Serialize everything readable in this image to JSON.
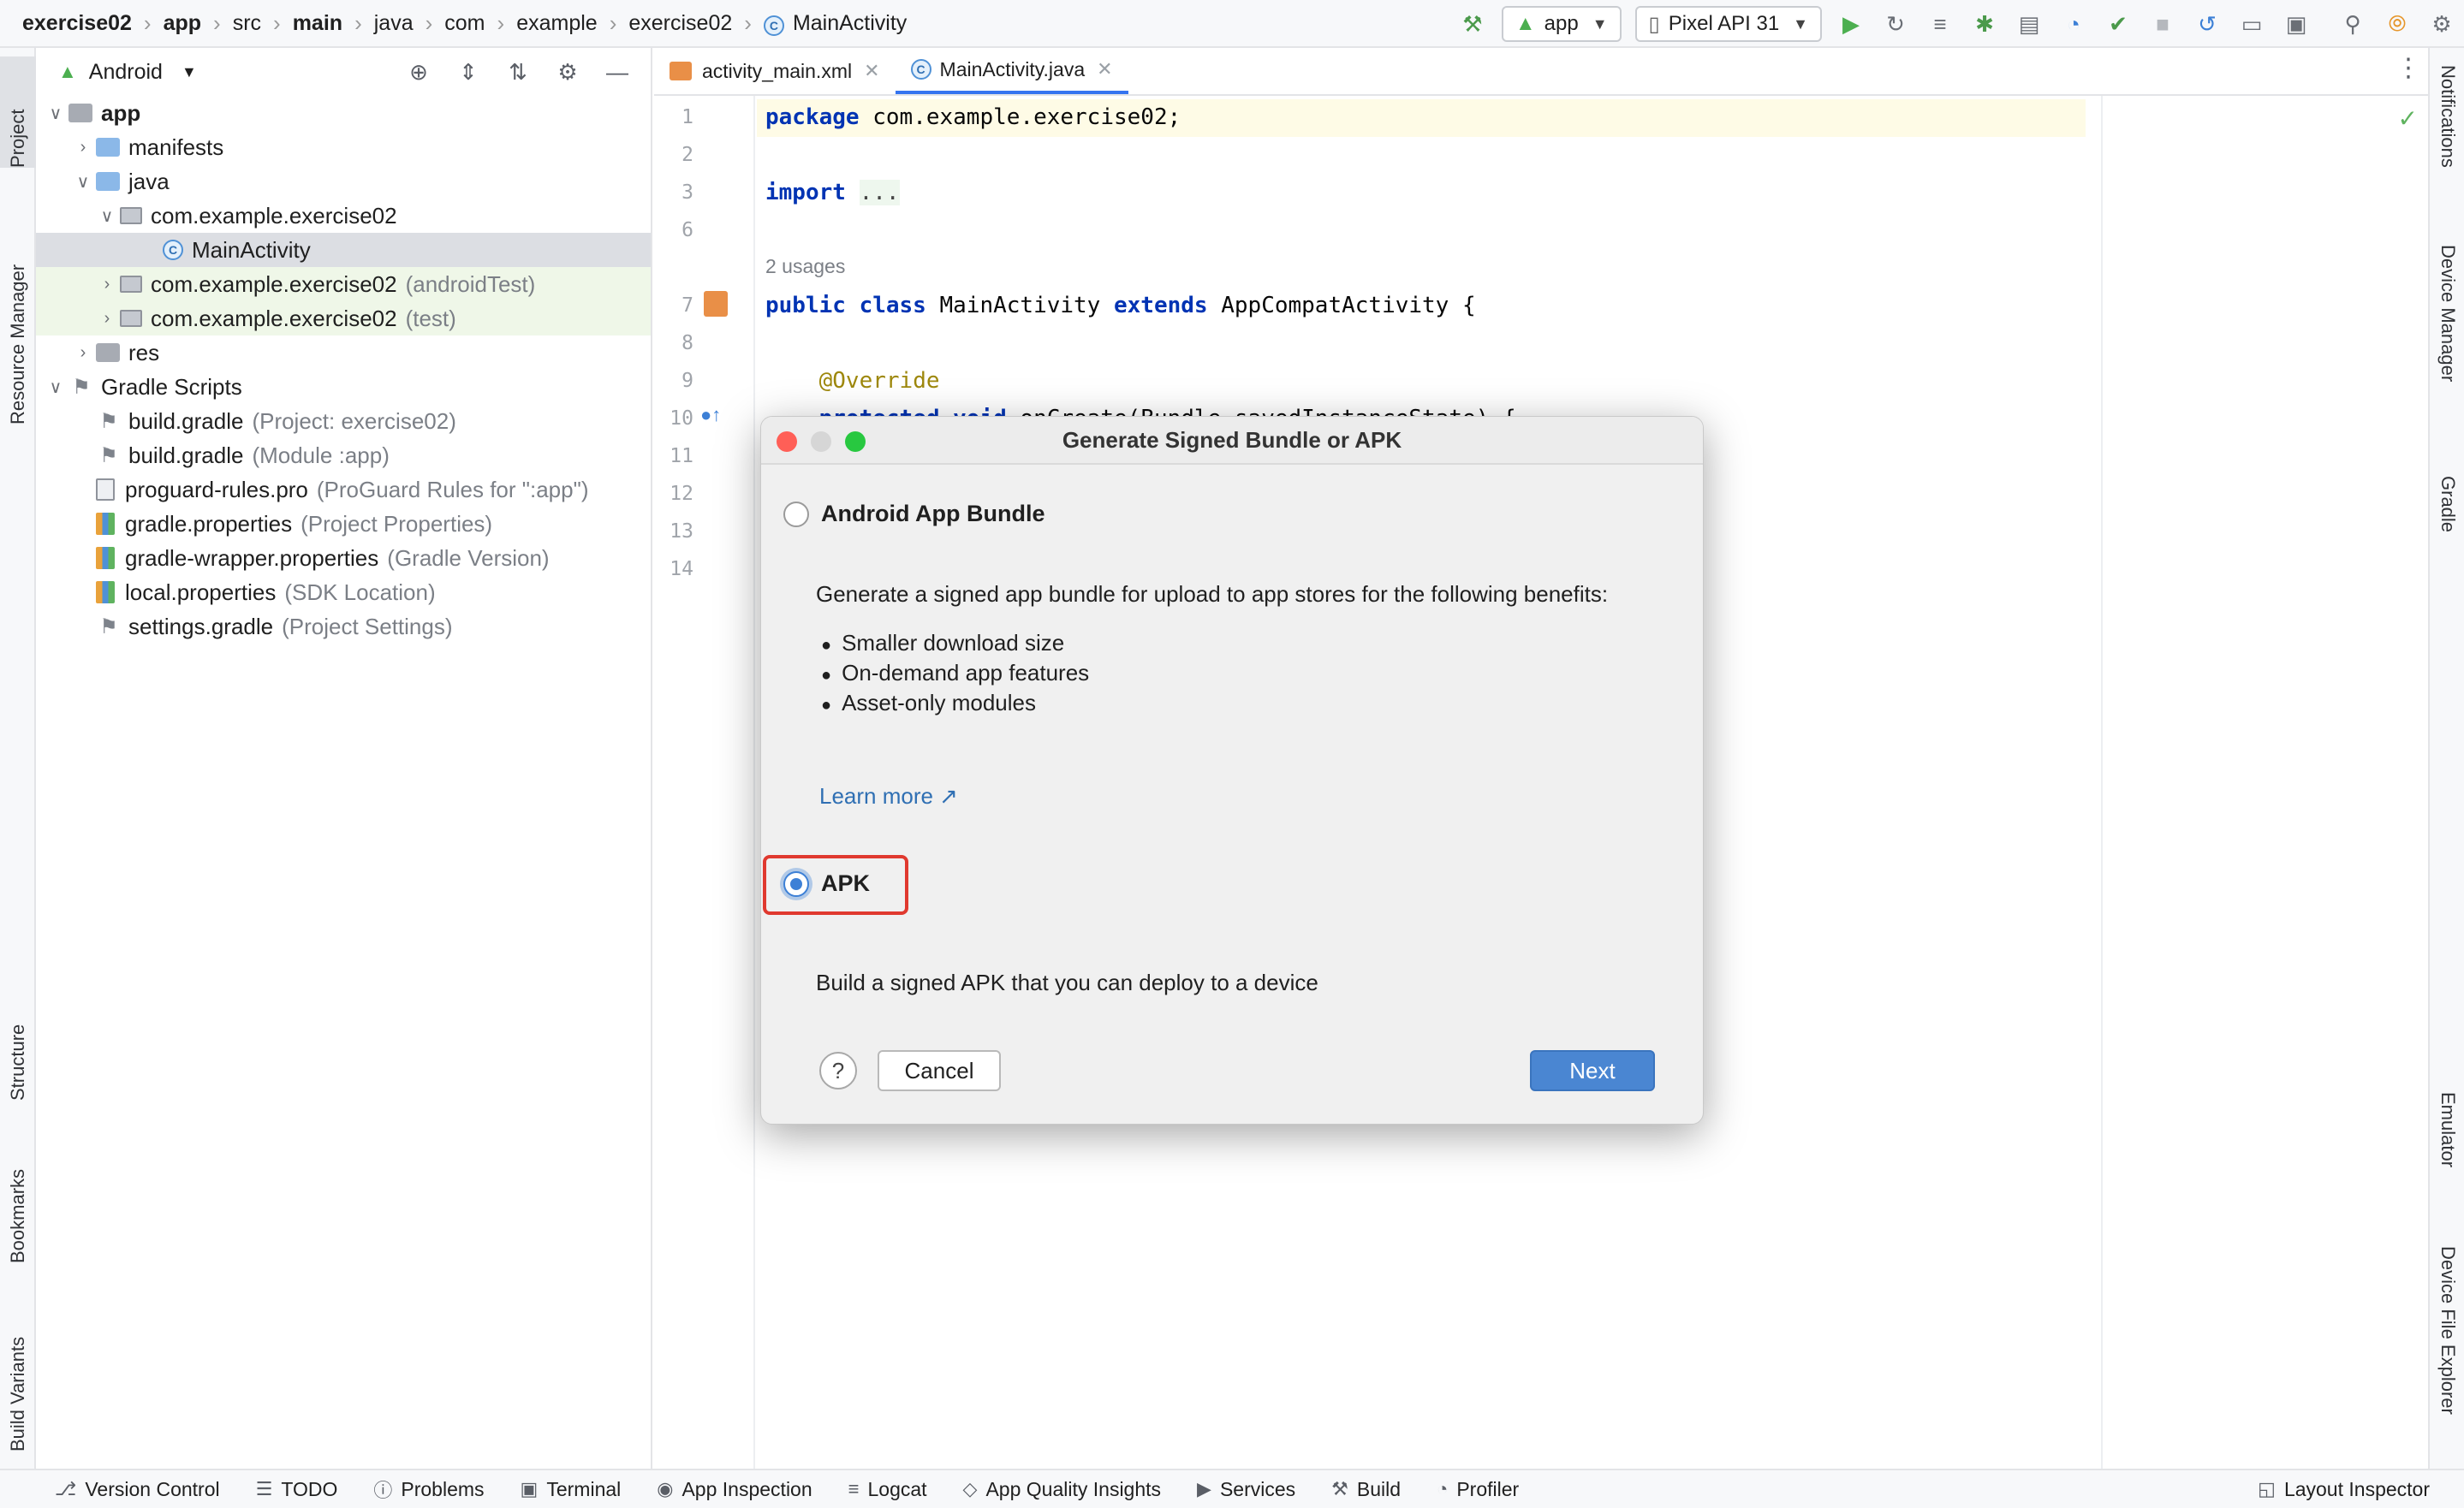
{
  "breadcrumbs": [
    {
      "label": "exercise02",
      "bold": true
    },
    {
      "label": "app",
      "bold": true
    },
    {
      "label": "src",
      "bold": false
    },
    {
      "label": "main",
      "bold": true
    },
    {
      "label": "java",
      "bold": false
    },
    {
      "label": "com",
      "bold": false
    },
    {
      "label": "example",
      "bold": false
    },
    {
      "label": "exercise02",
      "bold": false
    },
    {
      "label": "MainActivity",
      "bold": false
    }
  ],
  "toolbar": {
    "run_config": "app",
    "device": "Pixel API 31"
  },
  "left_tool_windows": [
    "Project",
    "Resource Manager",
    "Structure",
    "Bookmarks",
    "Build Variants"
  ],
  "right_tool_windows": [
    "Notifications",
    "Device Manager",
    "Gradle",
    "Emulator",
    "Device File Explorer"
  ],
  "project_panel": {
    "view_mode": "Android",
    "tree": [
      {
        "label": "app",
        "hint": "",
        "depth": 0,
        "arrow": "open",
        "icon": "folder-grey",
        "bold": true,
        "state": ""
      },
      {
        "label": "manifests",
        "hint": "",
        "depth": 1,
        "arrow": "closed",
        "icon": "folder-blue",
        "bold": false,
        "state": ""
      },
      {
        "label": "java",
        "hint": "",
        "depth": 1,
        "arrow": "open",
        "icon": "folder-blue",
        "bold": false,
        "state": ""
      },
      {
        "label": "com.example.exercise02",
        "hint": "",
        "depth": 2,
        "arrow": "open",
        "icon": "package",
        "bold": false,
        "state": ""
      },
      {
        "label": "MainActivity",
        "hint": "",
        "depth": 3,
        "arrow": "none",
        "icon": "class",
        "bold": false,
        "state": "selected"
      },
      {
        "label": "com.example.exercise02",
        "hint": "(androidTest)",
        "depth": 2,
        "arrow": "closed",
        "icon": "package",
        "bold": false,
        "state": "test"
      },
      {
        "label": "com.example.exercise02",
        "hint": "(test)",
        "depth": 2,
        "arrow": "closed",
        "icon": "package",
        "bold": false,
        "state": "test"
      },
      {
        "label": "res",
        "hint": "",
        "depth": 1,
        "arrow": "closed",
        "icon": "folder-grey",
        "bold": false,
        "state": ""
      },
      {
        "label": "Gradle Scripts",
        "hint": "",
        "depth": 0,
        "arrow": "open",
        "icon": "gradle",
        "bold": false,
        "state": ""
      },
      {
        "label": "build.gradle",
        "hint": "(Project: exercise02)",
        "depth": 1,
        "arrow": "none",
        "icon": "gradle",
        "bold": false,
        "state": ""
      },
      {
        "label": "build.gradle",
        "hint": "(Module :app)",
        "depth": 1,
        "arrow": "none",
        "icon": "gradle",
        "bold": false,
        "state": ""
      },
      {
        "label": "proguard-rules.pro",
        "hint": "(ProGuard Rules for \":app\")",
        "depth": 1,
        "arrow": "none",
        "icon": "file",
        "bold": false,
        "state": ""
      },
      {
        "label": "gradle.properties",
        "hint": "(Project Properties)",
        "depth": 1,
        "arrow": "none",
        "icon": "props",
        "bold": false,
        "state": ""
      },
      {
        "label": "gradle-wrapper.properties",
        "hint": "(Gradle Version)",
        "depth": 1,
        "arrow": "none",
        "icon": "props",
        "bold": false,
        "state": ""
      },
      {
        "label": "local.properties",
        "hint": "(SDK Location)",
        "depth": 1,
        "arrow": "none",
        "icon": "props",
        "bold": false,
        "state": ""
      },
      {
        "label": "settings.gradle",
        "hint": "(Project Settings)",
        "depth": 1,
        "arrow": "none",
        "icon": "gradle",
        "bold": false,
        "state": ""
      }
    ]
  },
  "editor": {
    "tabs": [
      {
        "label": "activity_main.xml",
        "active": false
      },
      {
        "label": "MainActivity.java",
        "active": true
      }
    ],
    "line_numbers": [
      "1",
      "2",
      "3",
      "6",
      "7",
      "8",
      "9",
      "10",
      "11",
      "12",
      "13",
      "14"
    ],
    "code": {
      "l1_kw": "package",
      "l1_rest": " com.example.exercise02;",
      "l3_kw": "import",
      "l3_fold": "...",
      "usages": "2 usages",
      "l7_kw1": "public class",
      "l7_name": " MainActivity ",
      "l7_kw2": "extends",
      "l7_rest": " AppCompatActivity {",
      "l9_ann": "@Override",
      "l10_kw": "protected void",
      "l10_rest": " onCreate(Bundle savedInstanceState) {"
    }
  },
  "dialog": {
    "title": "Generate Signed Bundle or APK",
    "option_bundle": "Android App Bundle",
    "bundle_desc": "Generate a signed app bundle for upload to app stores for the following benefits:",
    "benefits": [
      "Smaller download size",
      "On-demand app features",
      "Asset-only modules"
    ],
    "learn_more": "Learn more ↗",
    "option_apk": "APK",
    "apk_desc": "Build a signed APK that you can deploy to a device",
    "help": "?",
    "cancel": "Cancel",
    "next": "Next",
    "selected": "APK"
  },
  "bottom_tool_windows": [
    "Version Control",
    "TODO",
    "Problems",
    "Terminal",
    "App Inspection",
    "Logcat",
    "App Quality Insights",
    "Services",
    "Build",
    "Profiler"
  ],
  "bottom_right": "Layout Inspector"
}
